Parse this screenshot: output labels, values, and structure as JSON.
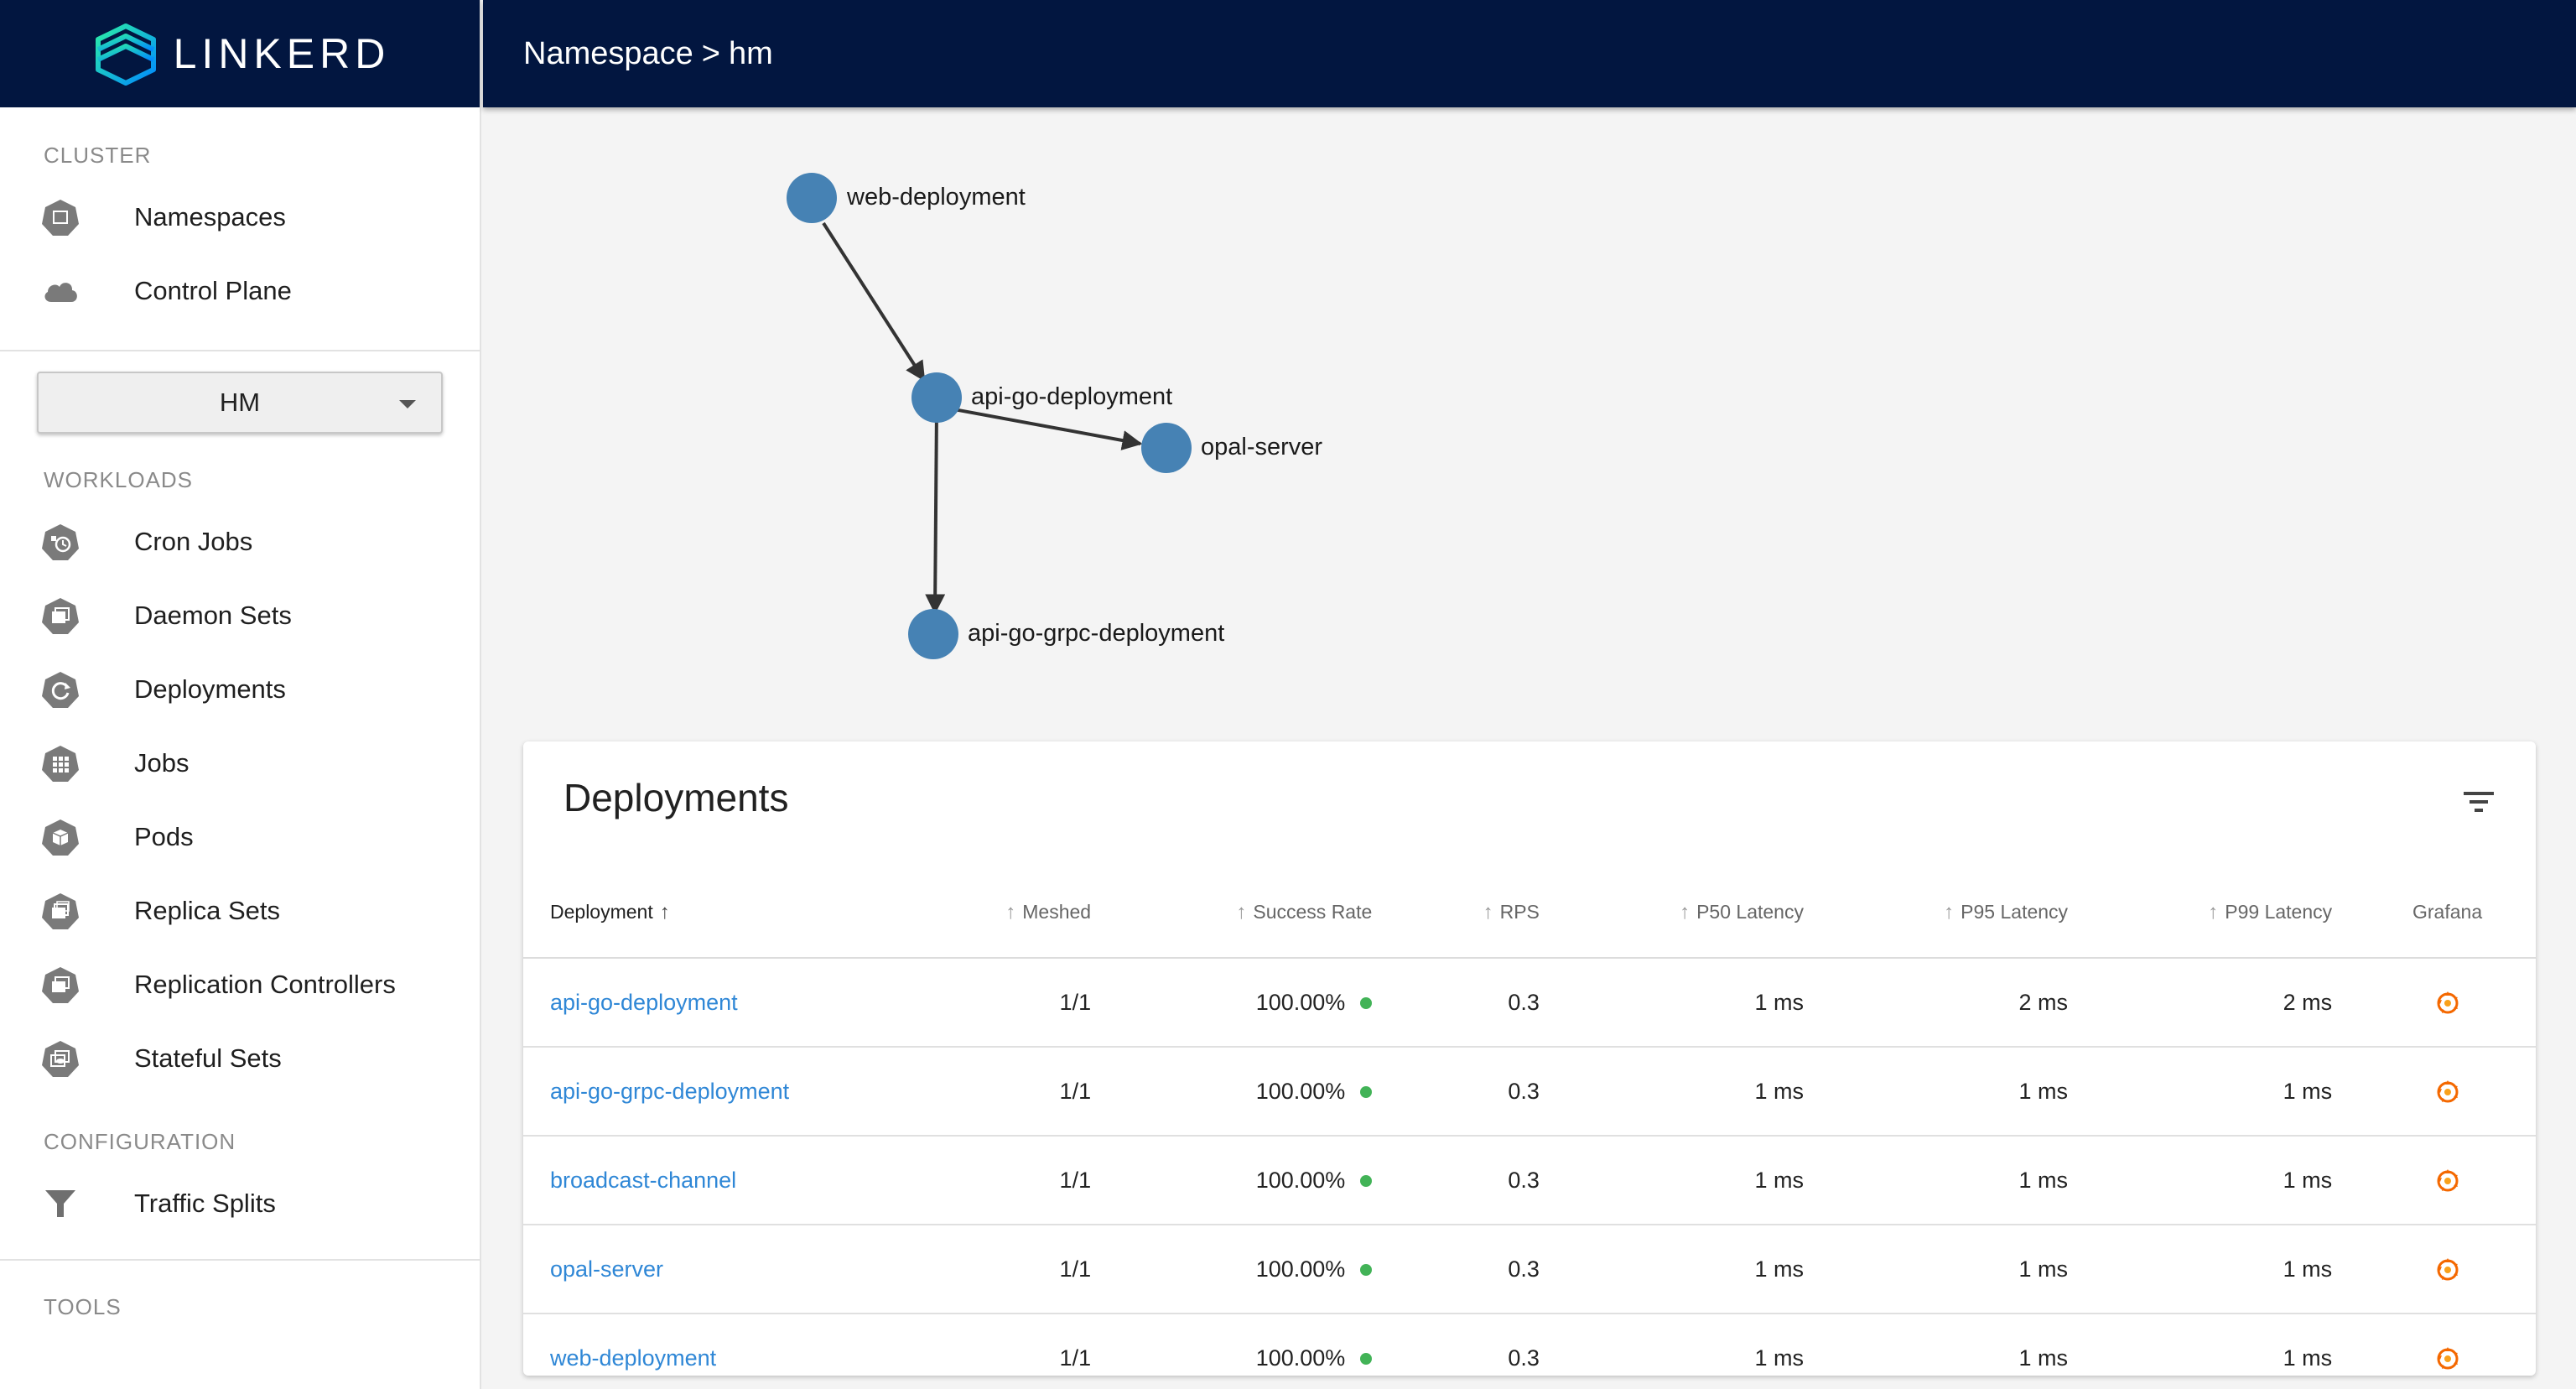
{
  "brand": {
    "name": "LINKERD"
  },
  "header": {
    "crumb_root": "Namespace",
    "separator": ">",
    "crumb_current": "hm"
  },
  "sidebar": {
    "cluster_label": "CLUSTER",
    "cluster_items": [
      {
        "label": "Namespaces",
        "icon": "namespace-icon"
      },
      {
        "label": "Control Plane",
        "icon": "cloud-icon"
      }
    ],
    "namespace_select": {
      "value": "HM"
    },
    "workloads_label": "WORKLOADS",
    "workload_items": [
      {
        "label": "Cron Jobs",
        "icon": "cronjob-icon"
      },
      {
        "label": "Daemon Sets",
        "icon": "daemonset-icon"
      },
      {
        "label": "Deployments",
        "icon": "deployment-icon"
      },
      {
        "label": "Jobs",
        "icon": "job-icon"
      },
      {
        "label": "Pods",
        "icon": "pod-icon"
      },
      {
        "label": "Replica Sets",
        "icon": "replicaset-icon"
      },
      {
        "label": "Replication Controllers",
        "icon": "replicationcontroller-icon"
      },
      {
        "label": "Stateful Sets",
        "icon": "statefulset-icon"
      }
    ],
    "configuration_label": "CONFIGURATION",
    "configuration_items": [
      {
        "label": "Traffic Splits",
        "icon": "filter-icon"
      }
    ],
    "tools_label": "TOOLS"
  },
  "graph": {
    "nodes": [
      "web-deployment",
      "api-go-deployment",
      "opal-server",
      "api-go-grpc-deployment"
    ],
    "edges": [
      {
        "from": "web-deployment",
        "to": "api-go-deployment"
      },
      {
        "from": "api-go-deployment",
        "to": "opal-server"
      },
      {
        "from": "api-go-deployment",
        "to": "api-go-grpc-deployment"
      }
    ],
    "node_color": "#4682b4"
  },
  "deployments": {
    "title": "Deployments",
    "columns": [
      "Deployment",
      "Meshed",
      "Success Rate",
      "RPS",
      "P50 Latency",
      "P95 Latency",
      "P99 Latency",
      "Grafana"
    ],
    "rows": [
      {
        "name": "api-go-deployment",
        "meshed": "1/1",
        "success_rate": "100.00%",
        "rps": "0.3",
        "p50": "1 ms",
        "p95": "2 ms",
        "p99": "2 ms"
      },
      {
        "name": "api-go-grpc-deployment",
        "meshed": "1/1",
        "success_rate": "100.00%",
        "rps": "0.3",
        "p50": "1 ms",
        "p95": "1 ms",
        "p99": "1 ms"
      },
      {
        "name": "broadcast-channel",
        "meshed": "1/1",
        "success_rate": "100.00%",
        "rps": "0.3",
        "p50": "1 ms",
        "p95": "1 ms",
        "p99": "1 ms"
      },
      {
        "name": "opal-server",
        "meshed": "1/1",
        "success_rate": "100.00%",
        "rps": "0.3",
        "p50": "1 ms",
        "p95": "1 ms",
        "p99": "1 ms"
      },
      {
        "name": "web-deployment",
        "meshed": "1/1",
        "success_rate": "100.00%",
        "rps": "0.3",
        "p50": "1 ms",
        "p95": "1 ms",
        "p99": "1 ms"
      }
    ],
    "success_color": "#42b357",
    "link_color": "#2f87d6"
  }
}
